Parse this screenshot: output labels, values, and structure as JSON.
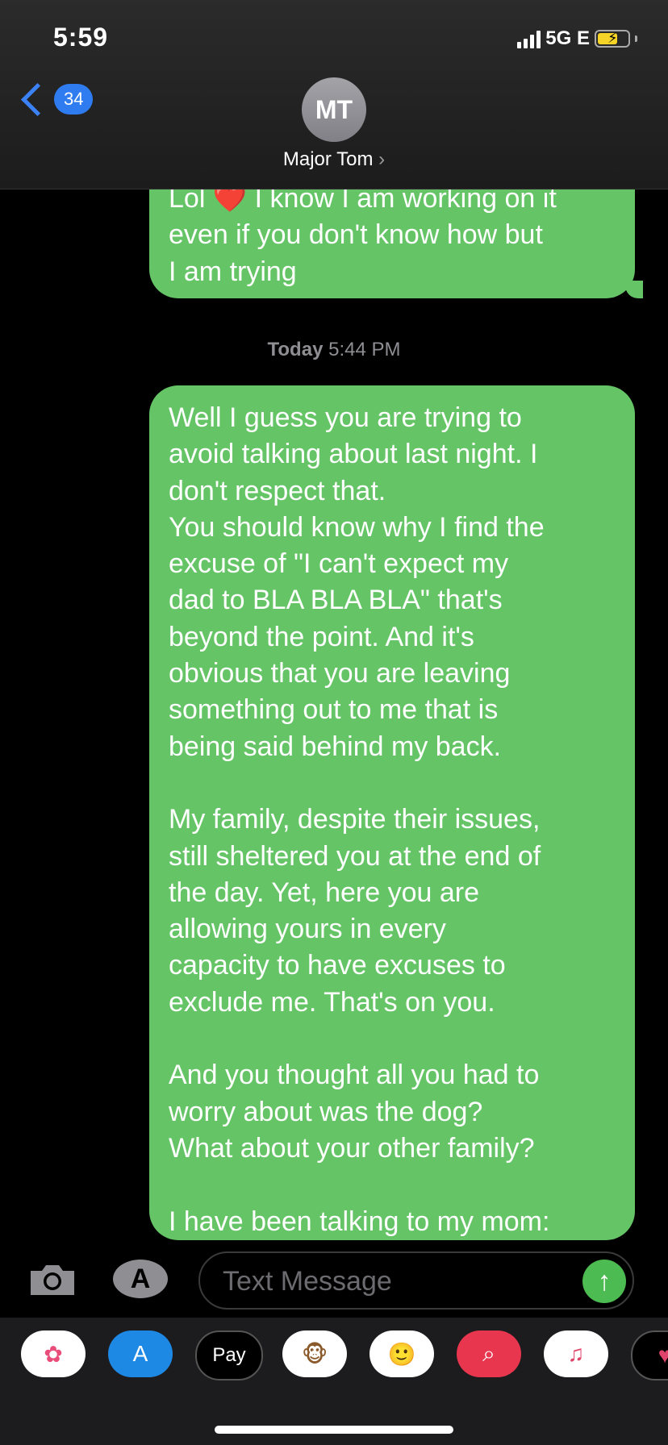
{
  "status_bar": {
    "time": "5:59",
    "network": "5G E"
  },
  "header": {
    "back_count": "34",
    "avatar_initials": "MT",
    "contact_name": "Major Tom",
    "contact_chevron": "›"
  },
  "messages": [
    {
      "direction": "outgoing",
      "prefix": "Lol ",
      "emoji": "❤️",
      "text": " I know I am working on it\neven if you don't know how but\nI am trying"
    },
    {
      "direction": "outgoing",
      "text": "Well I guess you are trying to\navoid talking about last night. I\ndon't respect that.\nYou should know why I find the\nexcuse of \"I can't expect my\ndad to BLA BLA BLA\" that's\nbeyond the point. And it's\nobvious that you are leaving\nsomething out to me that is\nbeing said behind my back.\n\nMy family, despite their issues,\nstill sheltered you at the end of\nthe day. Yet, here you are\nallowing yours in every\ncapacity to have excuses to\nexclude me. That's on you.\n\nAnd you thought all you had to\nworry about was the dog?\nWhat about your other family?\n\nI have been talking to my mom:"
    }
  ],
  "timestamp": {
    "day": "Today",
    "time": "5:44 PM"
  },
  "input": {
    "placeholder": "Text Message"
  },
  "app_drawer": [
    {
      "name": "photos-app",
      "icon": "photos-icon",
      "label": "",
      "bg": "#ffffff"
    },
    {
      "name": "app-store-app",
      "icon": "app-store-icon",
      "label": "",
      "bg": "#1e88e5"
    },
    {
      "name": "apple-pay-app",
      "icon": "apple-pay-icon",
      "label": "Pay",
      "bg": "#000000"
    },
    {
      "name": "animoji-app",
      "icon": "monkey-icon",
      "label": "",
      "bg": "#ffffff"
    },
    {
      "name": "memoji-app",
      "icon": "memoji-icon",
      "label": "",
      "bg": "#ffffff"
    },
    {
      "name": "images-search-app",
      "icon": "globe-search-icon",
      "label": "",
      "bg": "#e8364e"
    },
    {
      "name": "music-app",
      "icon": "music-note-icon",
      "label": "",
      "bg": "#ffffff"
    },
    {
      "name": "digital-touch-app",
      "icon": "heart-touch-icon",
      "label": "",
      "bg": "#000000"
    }
  ],
  "colors": {
    "bubble": "#65c466",
    "badge": "#2f7cf0",
    "send": "#4cbb52"
  }
}
